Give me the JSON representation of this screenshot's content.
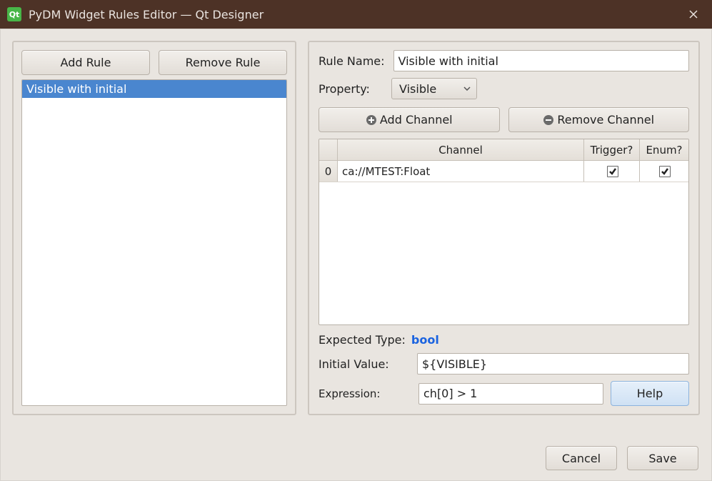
{
  "titlebar": {
    "title": "PyDM Widget Rules Editor — Qt Designer"
  },
  "left": {
    "add_label": "Add Rule",
    "remove_label": "Remove Rule",
    "rules": [
      "Visible with initial"
    ],
    "selected_index": 0
  },
  "form": {
    "rule_name_label": "Rule Name:",
    "rule_name_value": "Visible with initial",
    "property_label": "Property:",
    "property_value": "Visible",
    "add_channel_label": "Add Channel",
    "remove_channel_label": "Remove Channel",
    "table": {
      "headers": {
        "channel": "Channel",
        "trigger": "Trigger?",
        "enum": "Enum?"
      },
      "rows": [
        {
          "idx": "0",
          "channel": "ca://MTEST:Float",
          "trigger": true,
          "enum": true
        }
      ]
    },
    "expected_label": "Expected Type:",
    "expected_type": "bool",
    "initial_label": "Initial Value:",
    "initial_value": "${VISIBLE}",
    "expression_label": "Expression:",
    "expression_value": "ch[0] > 1",
    "help_label": "Help"
  },
  "dialog": {
    "cancel": "Cancel",
    "save": "Save"
  }
}
